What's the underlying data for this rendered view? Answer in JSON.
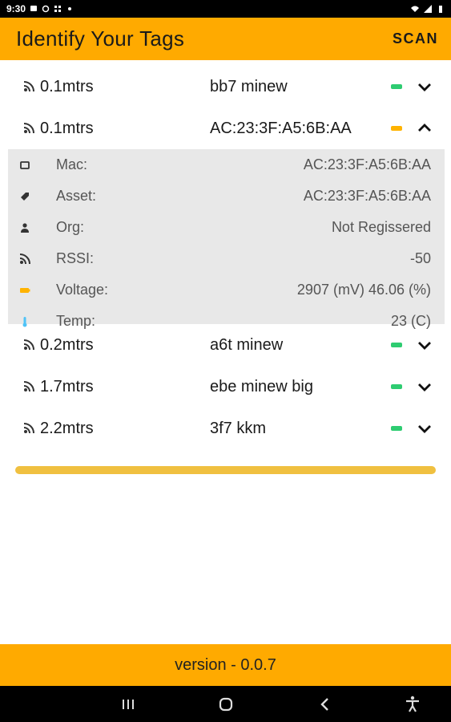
{
  "status_bar": {
    "time": "9:30"
  },
  "app_bar": {
    "title": "Identify Your Tags",
    "scan_label": "SCAN"
  },
  "colors": {
    "accent": "#ffaa00",
    "battery_good": "#2ecc71",
    "battery_mid": "#ffb300",
    "temp": "#4fc3f7"
  },
  "tags": [
    {
      "distance": "0.1mtrs",
      "name": "bb7 minew",
      "battery": "good",
      "expanded": false
    },
    {
      "distance": "0.1mtrs",
      "name": "AC:23:3F:A5:6B:AA",
      "battery": "mid",
      "expanded": true
    },
    {
      "distance": "0.2mtrs",
      "name": "a6t minew",
      "battery": "good",
      "expanded": false
    },
    {
      "distance": "1.7mtrs",
      "name": "ebe minew big",
      "battery": "good",
      "expanded": false
    },
    {
      "distance": "2.2mtrs",
      "name": "3f7 kkm",
      "battery": "good",
      "expanded": false
    }
  ],
  "details": [
    {
      "icon": "device-icon",
      "label": "Mac:",
      "value": "AC:23:3F:A5:6B:AA"
    },
    {
      "icon": "tag-icon",
      "label": "Asset:",
      "value": "AC:23:3F:A5:6B:AA"
    },
    {
      "icon": "person-icon",
      "label": "Org:",
      "value": "Not Regissered"
    },
    {
      "icon": "signal-icon",
      "label": "RSSI:",
      "value": "-50"
    },
    {
      "icon": "battery-icon",
      "label": "Voltage:",
      "value": "2907 (mV) 46.06 (%)"
    },
    {
      "icon": "thermometer-icon",
      "label": "Temp:",
      "value": "23 (C)"
    }
  ],
  "footer": {
    "version": "version - 0.0.7"
  }
}
